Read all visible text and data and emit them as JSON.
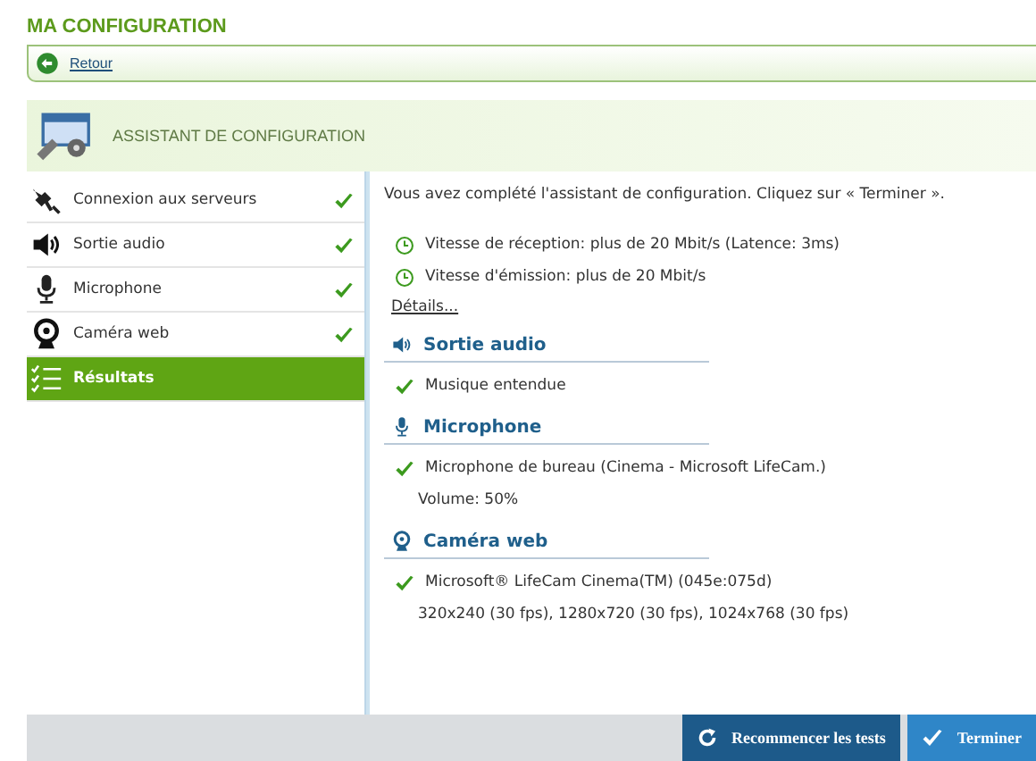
{
  "page_title": "MA CONFIGURATION",
  "back_link": "Retour",
  "wizard_title": "ASSISTANT DE CONFIGURATION",
  "steps": [
    {
      "label": "Connexion aux serveurs",
      "kind": "plug",
      "done": true,
      "selected": false
    },
    {
      "label": "Sortie audio",
      "kind": "speaker",
      "done": true,
      "selected": false
    },
    {
      "label": "Microphone",
      "kind": "mic",
      "done": true,
      "selected": false
    },
    {
      "label": "Caméra web",
      "kind": "webcam",
      "done": true,
      "selected": false
    },
    {
      "label": "Résultats",
      "kind": "list",
      "done": false,
      "selected": true
    }
  ],
  "intro": "Vous avez complété l'assistant de configuration. Cliquez sur « Terminer ».",
  "network_lines": [
    {
      "text": "Vitesse de réception: plus de 20 Mbit/s (Latence: 3ms)",
      "kind": "clock"
    },
    {
      "text": "Vitesse d'émission: plus de 20 Mbit/s",
      "kind": "clock"
    }
  ],
  "details_link": "Détails...",
  "sections": [
    {
      "title": "Sortie audio",
      "kind": "speaker",
      "lines": [
        {
          "text": "Musique entendue",
          "kind": "check"
        }
      ]
    },
    {
      "title": "Microphone",
      "kind": "mic",
      "lines": [
        {
          "text": "Microphone de bureau (Cinema - Microsoft LifeCam.)",
          "kind": "check"
        },
        {
          "text": "Volume: 50%",
          "kind": "plain"
        }
      ]
    },
    {
      "title": "Caméra web",
      "kind": "webcam",
      "lines": [
        {
          "text": "Microsoft® LifeCam Cinema(TM) (045e:075d)",
          "kind": "check"
        },
        {
          "text": "320x240 (30 fps), 1280x720 (30 fps), 1024x768 (30 fps)",
          "kind": "plain"
        }
      ]
    }
  ],
  "buttons": [
    {
      "label": "Recommencer les tests",
      "kind": "restart"
    },
    {
      "label": "Terminer",
      "kind": "finish"
    }
  ]
}
